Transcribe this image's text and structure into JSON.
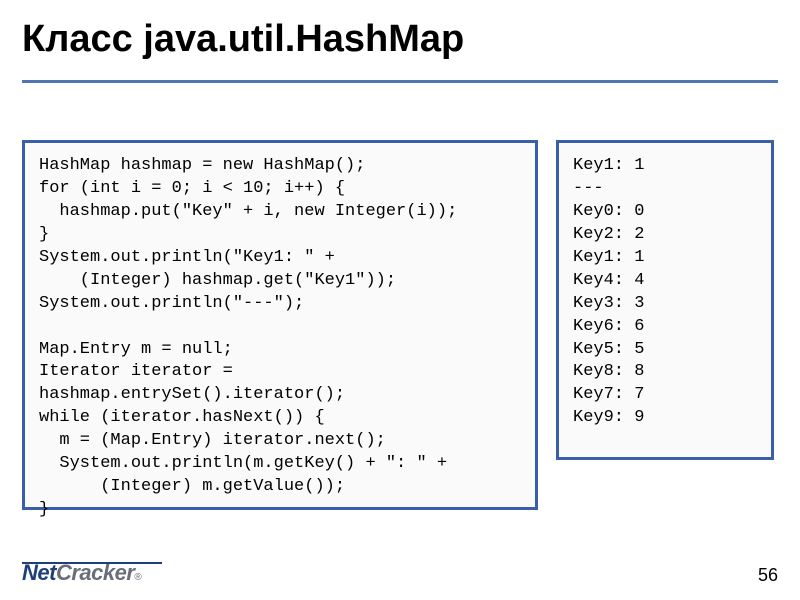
{
  "title": "Класс java.util.HashMap",
  "code_left": "HashMap hashmap = new HashMap();\nfor (int i = 0; i < 10; i++) {\n  hashmap.put(\"Key\" + i, new Integer(i));\n}\nSystem.out.println(\"Key1: \" +\n    (Integer) hashmap.get(\"Key1\"));\nSystem.out.println(\"---\");\n\nMap.Entry m = null;\nIterator iterator =\nhashmap.entrySet().iterator();\nwhile (iterator.hasNext()) {\n  m = (Map.Entry) iterator.next();\n  System.out.println(m.getKey() + \": \" +\n      (Integer) m.getValue());\n}",
  "code_right": "Key1: 1\n---\nKey0: 0\nKey2: 2\nKey1: 1\nKey4: 4\nKey3: 3\nKey6: 6\nKey5: 5\nKey8: 8\nKey7: 7\nKey9: 9",
  "logo": {
    "part1": "Net",
    "part2": "Cracker",
    "reg": "®"
  },
  "slide_number": "56"
}
